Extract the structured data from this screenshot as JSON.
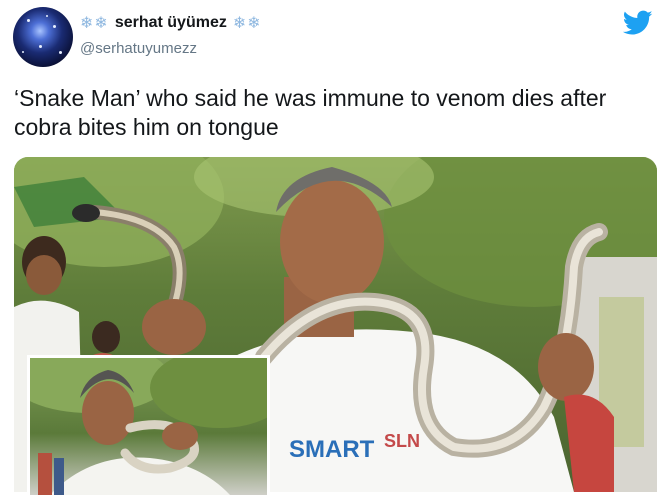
{
  "user": {
    "display_name": "serhat üyümez",
    "decor_left": "❄❄",
    "decor_right": "❄❄",
    "handle": "@serhatuyumezz"
  },
  "tweet": {
    "text": "‘Snake Man’ who said he was immune to venom dies after cobra bites him on tongue"
  },
  "icons": {
    "brand": "twitter-bird-icon",
    "brand_color": "#1da1f2"
  },
  "media": {
    "shirt_text_1": "SMART",
    "shirt_text_2": "SLN"
  }
}
